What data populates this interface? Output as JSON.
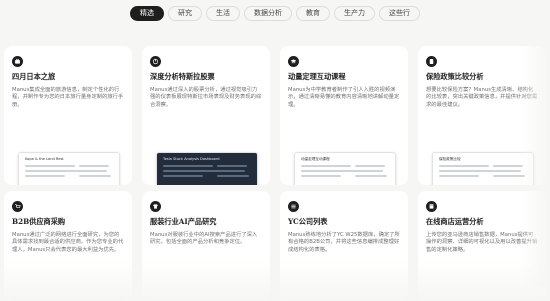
{
  "tabs": [
    {
      "label": "精选",
      "active": true
    },
    {
      "label": "研究",
      "active": false
    },
    {
      "label": "生活",
      "active": false
    },
    {
      "label": "数据分析",
      "active": false
    },
    {
      "label": "教育",
      "active": false
    },
    {
      "label": "生产力",
      "active": false
    },
    {
      "label": "这些行",
      "active": false
    }
  ],
  "cards": [
    {
      "title": "四月日本之旅",
      "icon": "suitcase-icon",
      "desc": "Manus集成全面的旅游信息，制定个性化的行程，并制作专为您的日本旅行量身定制的旅行手册。",
      "thumb_title": "Kopa & the Land Rest",
      "thumb_dark": false
    },
    {
      "title": "深度分析特斯拉股票",
      "icon": "chart-icon",
      "desc": "Manus通过深入的股票分析，通过视觉吸引力强的仪表板展现特斯拉市场表现及财务表现的综合洞察。",
      "thumb_title": "Tesla Stock Analysis Dashboard",
      "thumb_dark": true
    },
    {
      "title": "动量定理互动课程",
      "icon": "graduation-icon",
      "desc": "Manus为中学教育者制作了引人入胜的视频演示，通过清晰易懂的教育内容清晰地讲解动量定理。",
      "thumb_title": "动量定理互动课程",
      "thumb_dark": false
    },
    {
      "title": "保险政策比较分析",
      "icon": "document-icon",
      "desc": "想要比较保险方案？Manus生成清晰、结构化的比较表，突出关键政策信息，并提供针对您需求的最佳建议。",
      "thumb_title": "保险政策比较",
      "thumb_dark": false
    },
    {
      "title": "B2B供应商采购",
      "icon": "cart-icon",
      "desc": "Manus通过广泛的网络进行全面研究，为您的具体需求找到最合适的供应商。作为您专业的代理人，Manus只会代表您的最大利益为优先。",
      "thumb_title": "",
      "thumb_dark": false
    },
    {
      "title": "服装行业AI产品研究",
      "icon": "shirt-icon",
      "desc": "Manus对服装行业中的AI搜索产品进行了深入研究，包括全面的产品分析和竞争定位。",
      "thumb_title": "",
      "thumb_dark": false
    },
    {
      "title": "YC公司列表",
      "icon": "list-icon",
      "desc": "Manus熟练地分析了YC W25数据库，确定了所有合格的B2B公司，并将这些信息编排成整理好成结构化的表格。",
      "thumb_title": "",
      "thumb_dark": false
    },
    {
      "title": "在线商店运营分析",
      "icon": "store-icon",
      "desc": "上传您的亚马逊商店销售数据，Manus提供可操作的洞察、详细的可视化以及用以改善提升销售的定制化策略。",
      "thumb_title": "",
      "thumb_dark": false
    }
  ]
}
